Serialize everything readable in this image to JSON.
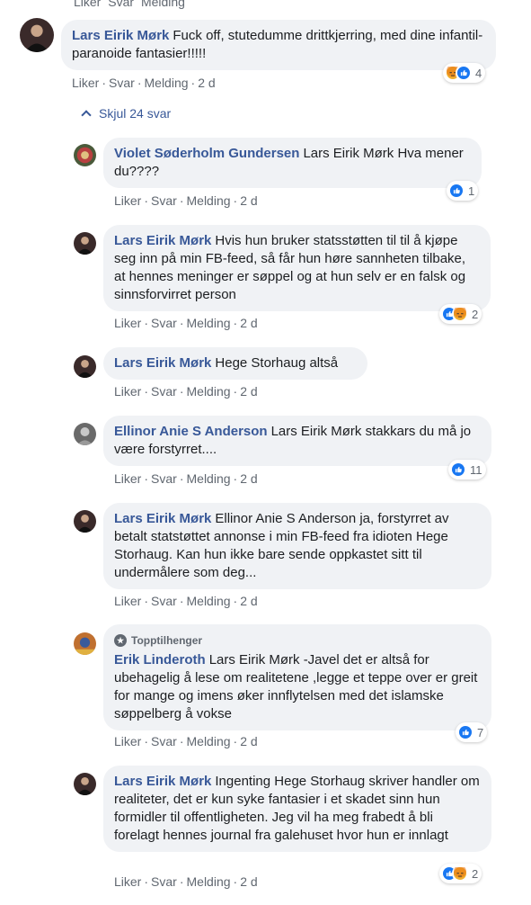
{
  "actions": {
    "like": "Liker",
    "reply": "Svar",
    "message": "Melding"
  },
  "hide_replies_label": "Skjul 24 svar",
  "top_fan_label": "Topptilhenger",
  "comments": [
    {
      "author": "Lars Eirik Mørk",
      "text": "Fuck off, stutedumme drittkjerring, med dine infantil-paranoide fantasier!!!!!",
      "time": "2 d",
      "reactions": [
        "angry-icon",
        "like-icon"
      ],
      "count": "4"
    },
    {
      "author": "Violet Søderholm Gundersen",
      "text": "Lars Eirik Mørk Hva mener du????",
      "time": "2 d",
      "reactions": [
        "like-icon"
      ],
      "count": "1"
    },
    {
      "author": "Lars Eirik Mørk",
      "text": "Hvis hun bruker statsstøtten til til å kjøpe seg inn på min FB-feed, så får hun høre sannheten tilbake, at hennes meninger er søppel og at hun selv er en falsk og sinnsforvirret person",
      "time": "2 d",
      "reactions": [
        "like-icon",
        "angry-icon"
      ],
      "count": "2"
    },
    {
      "author": "Lars Eirik Mørk",
      "text": "Hege Storhaug altså",
      "time": "2 d"
    },
    {
      "author": "Ellinor Anie S Anderson",
      "text": "Lars Eirik Mørk stakkars du må jo være forstyrret....",
      "time": "2 d",
      "reactions": [
        "like-icon"
      ],
      "count": "11"
    },
    {
      "author": "Lars Eirik Mørk",
      "text": "Ellinor Anie S Anderson ja, forstyrret av betalt statstøttet annonse i min FB-feed fra idioten Hege Storhaug. Kan hun ikke bare sende oppkastet sitt til undermålere som deg...",
      "time": "2 d"
    },
    {
      "author": "Erik Linderoth",
      "text": "Lars Eirik Mørk -Javel det er altså for ubehagelig å lese om realitetene ,legge et teppe over er greit for mange og imens øker innflytelsen med det islamske søppelberg å vokse",
      "time": "2 d",
      "reactions": [
        "like-icon"
      ],
      "count": "7"
    },
    {
      "author": "Lars Eirik Mørk",
      "text": "Ingenting Hege Storhaug skriver handler om realiteter, det er kun syke fantasier i et skadet sinn hun formidler til offentligheten. Jeg vil ha meg frabedt å bli forelagt hennes journal fra galehuset hvor hun er innlagt",
      "time": "2 d",
      "reactions": [
        "like-icon",
        "angry-icon"
      ],
      "count": "2"
    }
  ],
  "colors": {
    "link": "#385898",
    "bubble": "#f0f2f5",
    "meta": "#606770",
    "like": "#1877f2",
    "angry": "#f0b132"
  }
}
